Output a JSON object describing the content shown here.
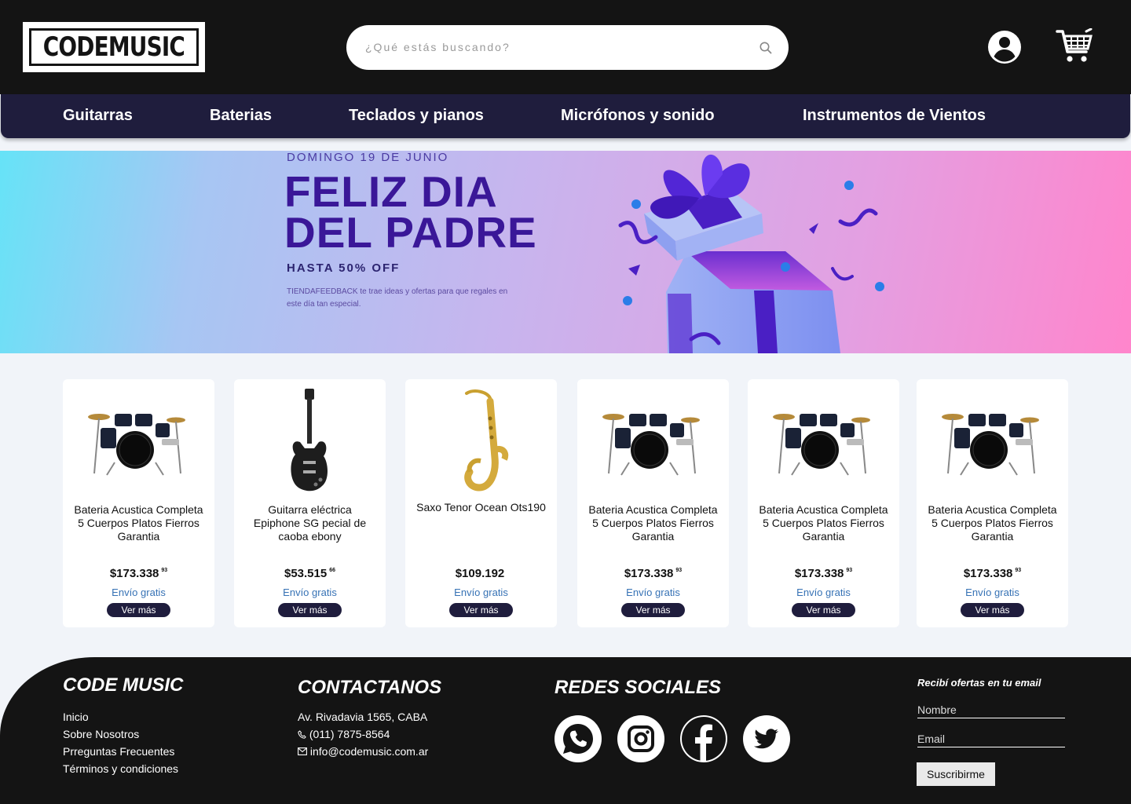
{
  "header": {
    "logo": "CODEMUSIC",
    "search_placeholder": "¿Qué estás buscando?"
  },
  "nav": [
    "Guitarras",
    "Baterias",
    "Teclados y pianos",
    "Micrófonos y sonido",
    "Instrumentos de Vientos"
  ],
  "banner": {
    "date": "DOMINGO 19 DE JUNIO",
    "title_line1": "FELIZ DIA",
    "title_line2": "DEL PADRE",
    "discount": "HASTA 50% OFF",
    "description": "TIENDAFEEDBACK te trae ideas y ofertas para que regales en este día tan especial."
  },
  "products": [
    {
      "name": "Bateria Acustica Completa 5 Cuerpos Platos Fierros Garantia",
      "price": "$173.338",
      "cents": "93",
      "shipping": "Envío gratis",
      "button": "Ver más",
      "icon": "drum-kit"
    },
    {
      "name": "Guitarra eléctrica Epiphone SG pecial de caoba ebony",
      "price": "$53.515",
      "cents": "66",
      "shipping": "Envío gratis",
      "button": "Ver más",
      "icon": "electric-guitar"
    },
    {
      "name": "Saxo Tenor Ocean Ots190",
      "price": "$109.192",
      "cents": "",
      "shipping": "Envío gratis",
      "button": "Ver más",
      "icon": "saxophone"
    },
    {
      "name": "Bateria Acustica Completa 5 Cuerpos Platos Fierros Garantia",
      "price": "$173.338",
      "cents": "93",
      "shipping": "Envío gratis",
      "button": "Ver más",
      "icon": "drum-kit"
    },
    {
      "name": "Bateria Acustica Completa 5 Cuerpos Platos Fierros Garantia",
      "price": "$173.338",
      "cents": "93",
      "shipping": "Envío gratis",
      "button": "Ver más",
      "icon": "drum-kit"
    },
    {
      "name": "Bateria Acustica Completa 5 Cuerpos Platos Fierros Garantia",
      "price": "$173.338",
      "cents": "93",
      "shipping": "Envío gratis",
      "button": "Ver más",
      "icon": "drum-kit"
    }
  ],
  "footer": {
    "brand": {
      "title": "CODE MUSIC",
      "links": [
        "Inicio",
        "Sobre Nosotros",
        "Prreguntas Frecuentes",
        "Términos y condiciones"
      ]
    },
    "contact": {
      "title": "CONTACTANOS",
      "address": "Av. Rivadavia 1565, CABA",
      "phone": "(011) 7875-8564",
      "email": "info@codemusic.com.ar"
    },
    "social": {
      "title": "REDES SOCIALES",
      "networks": [
        "whatsapp",
        "instagram",
        "facebook",
        "twitter"
      ]
    },
    "newsletter": {
      "title": "Recibí ofertas en tu email",
      "name_placeholder": "Nombre",
      "email_placeholder": "Email",
      "button": "Suscribirme"
    }
  }
}
